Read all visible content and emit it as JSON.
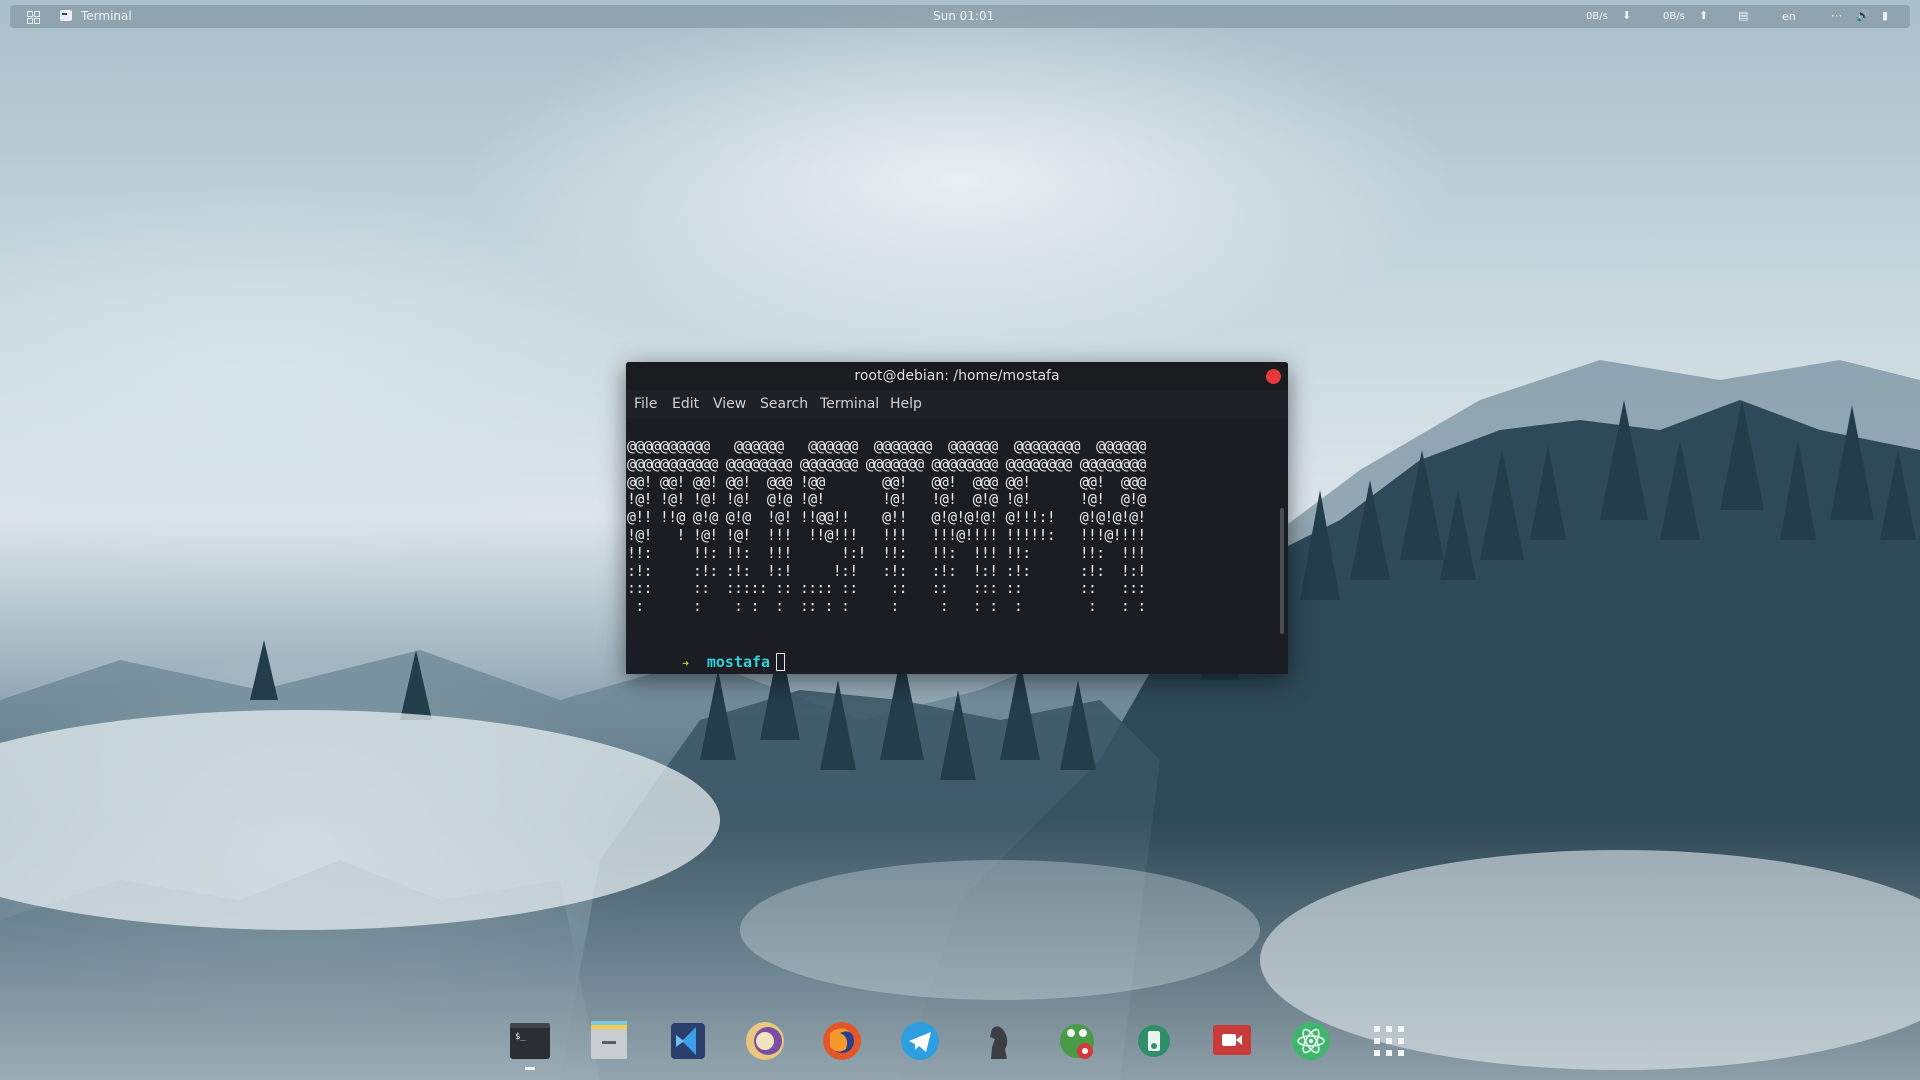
{
  "top_panel": {
    "app_name": "Terminal",
    "clock": "Sun 01:01",
    "net_down_speed": "0B/s",
    "net_up_speed": "0B/s",
    "language": "en",
    "icons": [
      "activities-icon",
      "terminal-app-icon",
      "download-arrow-icon",
      "upload-arrow-icon",
      "clipboard-icon",
      "more-icon",
      "volume-icon",
      "power-icon"
    ]
  },
  "terminal": {
    "title": "root@debian: /home/mostafa",
    "menu": [
      "File",
      "Edit",
      "View",
      "Search",
      "Terminal",
      "Help"
    ],
    "ascii_lines": [
      "@@@@@@@@@@   @@@@@@   @@@@@@  @@@@@@@  @@@@@@  @@@@@@@@  @@@@@@",
      "@@@@@@@@@@@ @@@@@@@@ @@@@@@@ @@@@@@@ @@@@@@@@ @@@@@@@@ @@@@@@@@",
      "@@! @@! @@! @@!  @@@ !@@       @@!   @@!  @@@ @@!      @@!  @@@",
      "!@! !@! !@! !@!  @!@ !@!       !@!   !@!  @!@ !@!      !@!  @!@",
      "@!! !!@ @!@ @!@  !@! !!@@!!    @!!   @!@!@!@! @!!!:!   @!@!@!@!",
      "!@!   ! !@! !@!  !!!  !!@!!!   !!!   !!!@!!!! !!!!!:   !!!@!!!!",
      "!!:     !!: !!:  !!!      !:!  !!:   !!:  !!! !!:      !!:  !!!",
      ":!:     :!: :!:  !:!     !:!   :!:   :!:  !:! :!:      :!:  !:!",
      ":::     ::  ::::: :: :::: ::    ::   ::   ::: ::       ::   :::",
      " :      :    : :  :  :: : :     :     :   : :  :        :   : :"
    ],
    "prompt_symbol": "➜",
    "prompt_user": "mostafa"
  },
  "dock": {
    "apps": [
      {
        "name": "terminal-dock-icon",
        "running": true
      },
      {
        "name": "files-dock-icon",
        "running": false
      },
      {
        "name": "vscode-dock-icon",
        "running": false
      },
      {
        "name": "eclipse-dock-icon",
        "running": false
      },
      {
        "name": "firefox-dock-icon",
        "running": false
      },
      {
        "name": "telegram-dock-icon",
        "running": false
      },
      {
        "name": "chess-dock-icon",
        "running": false
      },
      {
        "name": "gnome-tweaks-dock-icon",
        "running": false
      },
      {
        "name": "gparted-dock-icon",
        "running": false
      },
      {
        "name": "screen-recorder-dock-icon",
        "running": false
      },
      {
        "name": "atom-dock-icon",
        "running": false
      },
      {
        "name": "show-apps-icon",
        "running": false
      }
    ]
  },
  "colors": {
    "close_button": "#e8393a",
    "prompt_user": "#33d1d9",
    "prompt_arrow": "#c7d51e",
    "terminal_bg": "#1b1d22"
  }
}
